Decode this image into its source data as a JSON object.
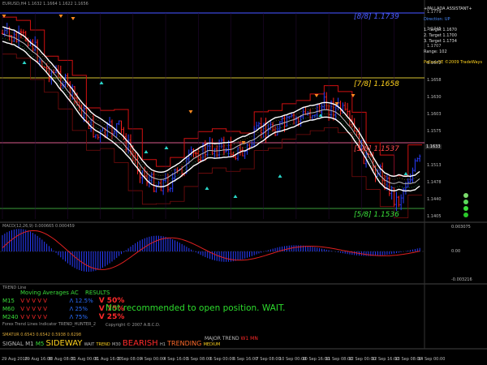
{
  "window": {
    "title_line": "PALLADA ASSISTANT",
    "top_left_caption": "EURUSD,H4  1.1632 1.1664 1.1622 1.1656"
  },
  "info_panel": {
    "lines": [
      "+PALLADA ASSISTANT+",
      "Direction: UP",
      "1. Target  1.1670",
      "2. Target  1.1700",
      "3. Target  1.1734",
      "Range: 102",
      "PalladaSE ©2009 TradeWays"
    ],
    "colors": [
      "#dddddd",
      "#4a8cff",
      "#dddddd",
      "#dddddd",
      "#dddddd",
      "#dddddd",
      "#ffd21e"
    ]
  },
  "levels": [
    {
      "label": "[8/8]  1.1739",
      "color": "#4b5cff"
    },
    {
      "label": "[7/8]  1.1658",
      "color": "#ffd21e"
    },
    {
      "label": "[5/8]  1.1537",
      "color": "#ff4a4a"
    },
    {
      "label": "[5/8]  1.1536",
      "color": "#3adf3a"
    }
  ],
  "price_axis": [
    "1.1779",
    "1.1745",
    "1.1707",
    "1.1672",
    "1.1658",
    "1.1630",
    "1.1603",
    "1.1575",
    "1.1548",
    "1.1513",
    "1.1478",
    "1.1440",
    "1.1405"
  ],
  "price_current": "1.1633",
  "macd": {
    "caption": "MACD(12,26,9) 0.000665 0.000459",
    "axis": [
      "0.003075",
      "0.00",
      "-0.003216"
    ]
  },
  "indicator": {
    "caption": "TREND Line",
    "header": [
      "Moving Averages",
      "AC",
      "RESULTS"
    ],
    "rows": [
      {
        "tf": "M15",
        "marks": "V  V  V  V  V",
        "arrow": "Λ 12.5%",
        "result": "V 50%",
        "arrow_color": "#2a6dff",
        "result_color": "#ff2a2a"
      },
      {
        "tf": "M60",
        "marks": "V  V  V  V  V",
        "arrow": "Λ 25%",
        "result": "V 75%",
        "arrow_color": "#2a6dff",
        "result_color": "#ff2a2a"
      },
      {
        "tf": "M240",
        "marks": "V  V  V  V  V",
        "arrow": "Λ 75%",
        "result": "V 25%",
        "arrow_color": "#2a6dff",
        "result_color": "#ff2a2a"
      }
    ],
    "note": "Forex Trend Lines Indicator  TREND_HUNTER_2",
    "copyright": "Copyright © 2007 A.B.C.D.",
    "message": "Not recommended to open position. WAIT.",
    "bottom_caption": "SMATUR 0.6543  0.6542  0.5938  0.6298"
  },
  "signal_bar": {
    "prefix": "SIGNAL M1",
    "items": [
      {
        "text": "M5",
        "color": "#3adf3a"
      },
      {
        "text": "SIDEWAY",
        "color": "#ffd21e"
      },
      {
        "text": "WAIT",
        "color": "#bbbbbb"
      },
      {
        "text": "TREND",
        "color": "#ffd21e"
      },
      {
        "text": "M30",
        "color": "#bbbbbb"
      },
      {
        "text": "BEARISH",
        "color": "#ff2a2a"
      },
      {
        "text": "H1",
        "color": "#bbbbbb"
      },
      {
        "text": "TRENDING",
        "color": "#ff6a2a"
      },
      {
        "text": "MEDIUM",
        "color": "#ffd21e"
      }
    ],
    "major": "MAJOR TREND",
    "major_tf": "W1 MN"
  },
  "time_axis": [
    "29 Aug 2018",
    "29 Aug 16:00",
    "30 Aug 08:00",
    "31 Aug 00:00",
    "31 Aug 16:00",
    "3 Sep 08:00",
    "4 Sep 00:00",
    "4 Sep 16:00",
    "5 Sep 08:00",
    "6 Sep 00:00",
    "6 Sep 16:00",
    "7 Sep 08:00",
    "10 Sep 00:00",
    "10 Sep 16:00",
    "11 Sep 08:00",
    "12 Sep 00:00",
    "12 Sep 16:00",
    "13 Sep 08:00",
    "14 Sep 00:00"
  ],
  "right_dots": [
    "#7bdc6c",
    "#5ad65a",
    "#3adf3a",
    "#2ac82a"
  ]
}
